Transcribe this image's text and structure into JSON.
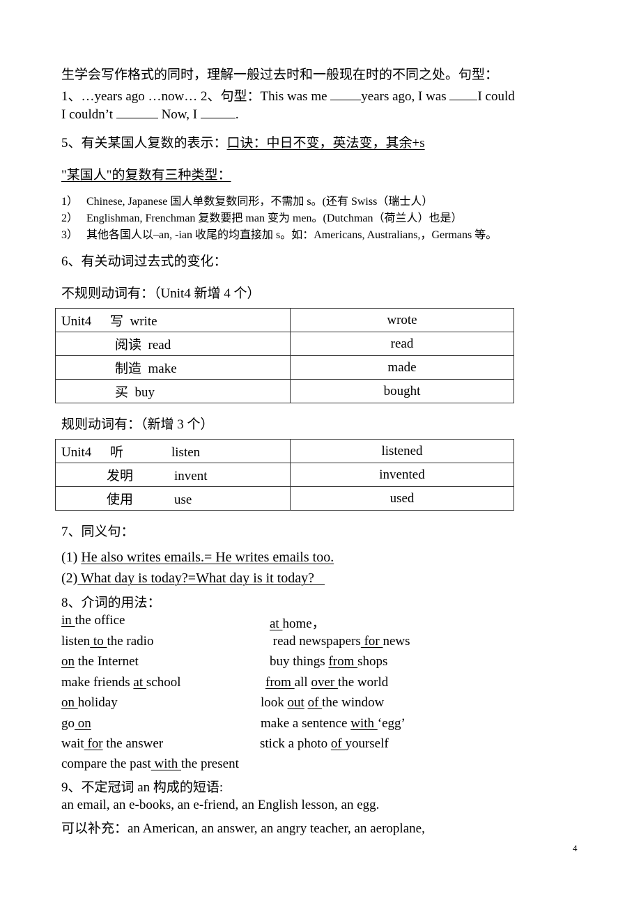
{
  "intro": {
    "line1": "生学会写作格式的同时，理解一般过去时和一般现在时的不同之处。句型：",
    "line2_a": "1、…years ago  …now…  2、句型：This was me ",
    "line2_b": "years ago, I was ",
    "line2_c": "I could",
    "line3_a": "I couldn’t ",
    "line3_b": " Now, I ",
    "line3_c": "."
  },
  "section5": {
    "heading_prefix": "5、有关某国人复数的表示：",
    "heading_rule": "口诀：中日不变，英法变，其余+s",
    "subheading": "\"某国人\"的复数有三种类型：",
    "items": [
      {
        "num": "1）",
        "text": "Chinese, Japanese 国人单数复数同形，不需加 s。(还有  Swiss（瑞士人）"
      },
      {
        "num": "2）",
        "text": "Englishman, Frenchman 复数要把 man  变为 men。(Dutchman（荷兰人）也是）"
      },
      {
        "num": "3）",
        "text": "其他各国人以–an, -ian 收尾的均直接加 s。如：Americans, Australians,，Germans 等。"
      }
    ]
  },
  "section6": {
    "heading": "6、有关动词过去式的变化：",
    "irregular_title": "不规则动词有：（Unit4 新增 4 个）",
    "irregular_rows": [
      {
        "unit": "Unit4",
        "cn": "写",
        "en": "write",
        "past": "wrote"
      },
      {
        "unit": "",
        "cn": "阅读",
        "en": "read",
        "past": "read"
      },
      {
        "unit": "",
        "cn": "制造",
        "en": "make",
        "past": "made"
      },
      {
        "unit": "",
        "cn": "买",
        "en": "buy",
        "past": "bought"
      }
    ],
    "regular_title": "规则动词有：（新增 3 个）",
    "regular_rows": [
      {
        "unit": "Unit4",
        "cn": "听",
        "en": "listen",
        "past": "listened"
      },
      {
        "unit": "",
        "cn": "发明",
        "en": "invent",
        "past": "invented"
      },
      {
        "unit": "",
        "cn": "使用",
        "en": "use",
        "past": "used"
      }
    ]
  },
  "section7": {
    "heading": "7、同义句：",
    "items": [
      {
        "num": "(1) ",
        "text": "He also writes emails.= He writes emails too."
      },
      {
        "num": "(2)",
        "text": " What day is today?=What day is it today?   "
      }
    ]
  },
  "section8": {
    "heading": "8、介词的用法：",
    "left": [
      [
        {
          "u": "in "
        },
        {
          "t": "the office"
        }
      ],
      [
        {
          "t": "listen"
        },
        {
          "u": " to "
        },
        {
          "t": "the radio"
        }
      ],
      [
        {
          "u": "on"
        },
        {
          "t": " the Internet"
        }
      ],
      [
        {
          "t": "make friends "
        },
        {
          "u": "at "
        },
        {
          "t": "school"
        }
      ],
      [
        {
          "u": "on "
        },
        {
          "t": "holiday"
        }
      ],
      [
        {
          "t": "go"
        },
        {
          "u": " on"
        }
      ],
      [
        {
          "t": "wait"
        },
        {
          "u": " for"
        },
        {
          "t": " the answer"
        }
      ],
      [
        {
          "t": "compare the past"
        },
        {
          "u": " with "
        },
        {
          "t": "the present"
        }
      ]
    ],
    "right": [
      [
        {
          "u": "at "
        },
        {
          "t": "home，"
        }
      ],
      [
        {
          "t": " read newspapers"
        },
        {
          "u": " for "
        },
        {
          "t": "news"
        }
      ],
      [
        {
          "t": "buy things "
        },
        {
          "u": "from "
        },
        {
          "t": "shops"
        }
      ],
      [
        {
          "u": "from "
        },
        {
          "t": "all "
        },
        {
          "u": "over "
        },
        {
          "t": "the world"
        }
      ],
      [
        {
          "t": "look "
        },
        {
          "u": "out"
        },
        {
          "t": " "
        },
        {
          "u": "of "
        },
        {
          "t": "the window"
        }
      ],
      [
        {
          "t": "make a sentence "
        },
        {
          "u": "with "
        },
        {
          "t": "‘egg’"
        }
      ],
      [
        {
          "t": "stick a photo "
        },
        {
          "u": "of "
        },
        {
          "t": "yourself"
        }
      ]
    ]
  },
  "section9": {
    "heading": "9、不定冠词 an 构成的短语:",
    "line1": "an email,    an e-books, an e-friend, an English lesson, an egg.",
    "line2": "可以补充：an American, an answer, an angry teacher, an aeroplane,"
  },
  "footer": {
    "page_number": "4"
  }
}
